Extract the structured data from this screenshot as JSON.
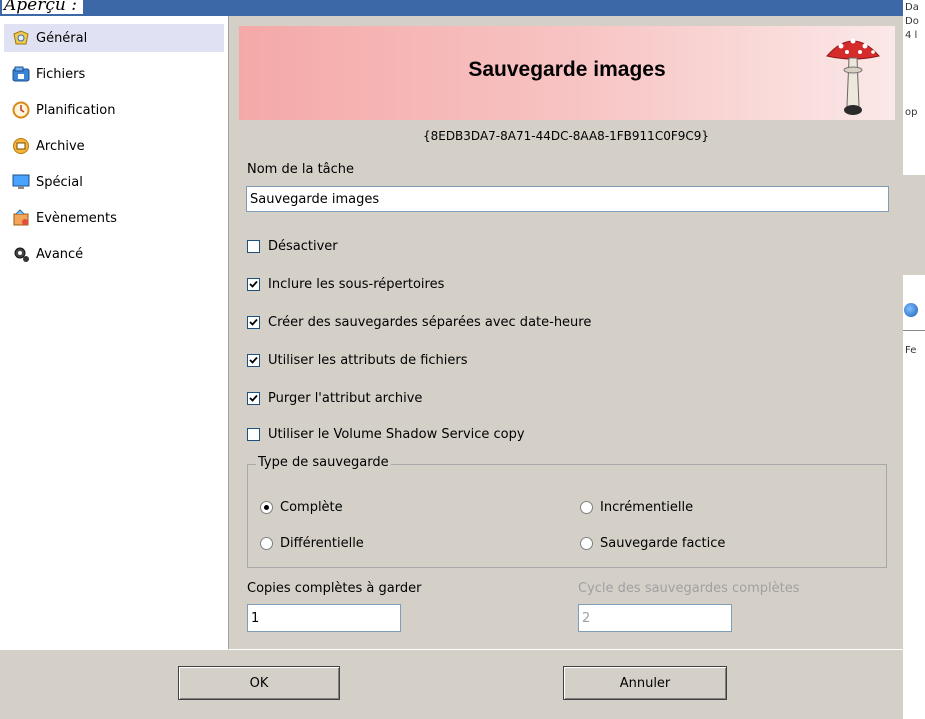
{
  "caption": "Aperçu :",
  "sidebar": {
    "items": [
      {
        "label": "Général"
      },
      {
        "label": "Fichiers"
      },
      {
        "label": "Planification"
      },
      {
        "label": "Archive"
      },
      {
        "label": "Spécial"
      },
      {
        "label": "Evènements"
      },
      {
        "label": "Avancé"
      }
    ]
  },
  "banner": {
    "title": "Sauvegarde images",
    "icon": "mushroom-icon"
  },
  "guid": "{8EDB3DA7-8A71-44DC-8AA8-1FB911C0F9C9}",
  "task": {
    "name_label": "Nom de la tâche",
    "name_value": "Sauvegarde images"
  },
  "options": [
    {
      "label": "Désactiver",
      "checked": false
    },
    {
      "label": "Inclure les sous-répertoires",
      "checked": true
    },
    {
      "label": "Créer des sauvegardes séparées avec date-heure",
      "checked": true
    },
    {
      "label": "Utiliser les attributs de fichiers",
      "checked": true
    },
    {
      "label": "Purger l'attribut archive",
      "checked": true
    },
    {
      "label": "Utiliser le Volume Shadow Service copy",
      "checked": false
    }
  ],
  "backup_type": {
    "legend": "Type de sauvegarde",
    "options": [
      {
        "label": "Complète",
        "selected": true
      },
      {
        "label": "Incrémentielle",
        "selected": false
      },
      {
        "label": "Différentielle",
        "selected": false
      },
      {
        "label": "Sauvegarde factice",
        "selected": false
      }
    ]
  },
  "copies": {
    "label": "Copies complètes à garder",
    "value": "1"
  },
  "cycle": {
    "label": "Cycle des sauvegardes complètes",
    "value": "2"
  },
  "buttons": {
    "ok": "OK",
    "cancel": "Annuler"
  },
  "right_edge": {
    "lines": [
      "Da",
      "Do",
      "4 l",
      "op",
      "Fe"
    ]
  },
  "colors": {
    "dialog_bg": "#d4d0c8",
    "title_bar": "#3c68a8",
    "banner_left": "#f4a9a8",
    "banner_right": "#fbe8e8",
    "selected_item": "#e1e1f4"
  }
}
